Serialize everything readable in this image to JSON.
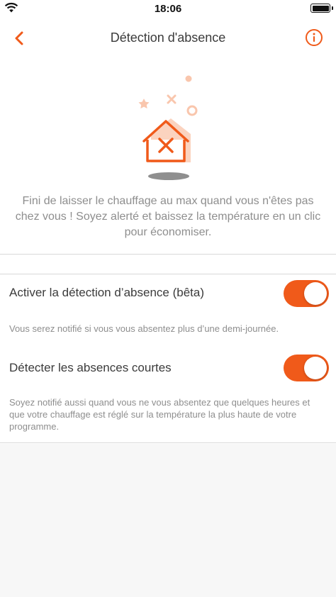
{
  "status_bar": {
    "time": "18:06"
  },
  "nav": {
    "title": "Détection d'absence"
  },
  "intro_text": "Fini de laisser le chauffage au max quand vous n'êtes pas chez vous ! Soyez alerté et baissez la température en un clic pour économiser.",
  "settings": [
    {
      "label": "Activer la détection d’absence (bêta)",
      "description": "Vous serez notifié si vous vous absentez plus d’une demi-journée.",
      "enabled": true
    },
    {
      "label": "Détecter les absences courtes",
      "description": "Soyez notifié aussi quand vous ne vous absentez que quelques heures et que votre chauffage est réglé sur la température la plus haute de votre programme.",
      "enabled": true
    }
  ],
  "colors": {
    "accent": "#f05a1a",
    "text": "#3b3b3b",
    "muted": "#8e8e8e"
  },
  "icons": [
    "wifi-icon",
    "battery-icon",
    "back-chevron-icon",
    "info-icon",
    "house-absence-icon"
  ]
}
